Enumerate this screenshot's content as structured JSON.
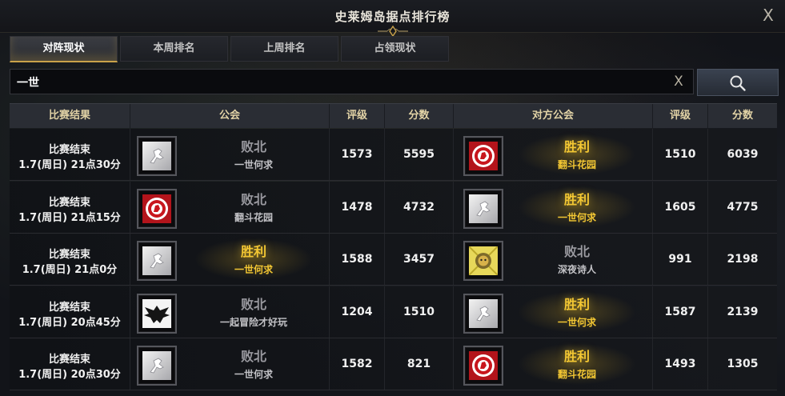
{
  "window": {
    "title": "史莱姆岛据点排行榜",
    "close_label": "X"
  },
  "tabs": [
    {
      "label": "对阵现状",
      "active": true
    },
    {
      "label": "本周排名",
      "active": false
    },
    {
      "label": "上周排名",
      "active": false
    },
    {
      "label": "占领现状",
      "active": false
    }
  ],
  "search": {
    "value": "一世",
    "clear_label": "X"
  },
  "columns": {
    "result": "比赛结果",
    "guild": "公会",
    "rating": "评级",
    "score": "分数",
    "opponent": "对方公会",
    "opp_rating": "评级",
    "opp_score": "分数"
  },
  "colors": {
    "win": "#f3c733",
    "lose": "#9a9aa0",
    "header_text": "#e2d3a6",
    "tab_accent": "#c9a24a"
  },
  "rows": [
    {
      "status": "比赛结束",
      "time": "1.7(周日) 21点30分",
      "guild": {
        "outcome": "败北",
        "name": "一世何求",
        "emblem": "white-flag-emblem",
        "win": false
      },
      "rating": "1573",
      "score": "5595",
      "opponent": {
        "outcome": "胜利",
        "name": "翻斗花园",
        "emblem": "red-shield-emblem",
        "win": true
      },
      "opp_rating": "1510",
      "opp_score": "6039"
    },
    {
      "status": "比赛结束",
      "time": "1.7(周日) 21点15分",
      "guild": {
        "outcome": "败北",
        "name": "翻斗花园",
        "emblem": "red-shield-emblem",
        "win": false
      },
      "rating": "1478",
      "score": "4732",
      "opponent": {
        "outcome": "胜利",
        "name": "一世何求",
        "emblem": "white-flag-emblem",
        "win": true
      },
      "opp_rating": "1605",
      "opp_score": "4775"
    },
    {
      "status": "比赛结束",
      "time": "1.7(周日) 21点0分",
      "guild": {
        "outcome": "胜利",
        "name": "一世何求",
        "emblem": "white-flag-emblem",
        "win": true
      },
      "rating": "1588",
      "score": "3457",
      "opponent": {
        "outcome": "败北",
        "name": "深夜诗人",
        "emblem": "lion-emblem",
        "win": false
      },
      "opp_rating": "991",
      "opp_score": "2198"
    },
    {
      "status": "比赛结束",
      "time": "1.7(周日) 20点45分",
      "guild": {
        "outcome": "败北",
        "name": "一起冒险才好玩",
        "emblem": "black-eagle-emblem",
        "win": false
      },
      "rating": "1204",
      "score": "1510",
      "opponent": {
        "outcome": "胜利",
        "name": "一世何求",
        "emblem": "white-flag-emblem",
        "win": true
      },
      "opp_rating": "1587",
      "opp_score": "2139"
    },
    {
      "status": "比赛结束",
      "time": "1.7(周日) 20点30分",
      "guild": {
        "outcome": "败北",
        "name": "一世何求",
        "emblem": "white-flag-emblem",
        "win": false
      },
      "rating": "1582",
      "score": "821",
      "opponent": {
        "outcome": "胜利",
        "name": "翻斗花园",
        "emblem": "red-shield-emblem",
        "win": true
      },
      "opp_rating": "1493",
      "opp_score": "1305"
    }
  ]
}
